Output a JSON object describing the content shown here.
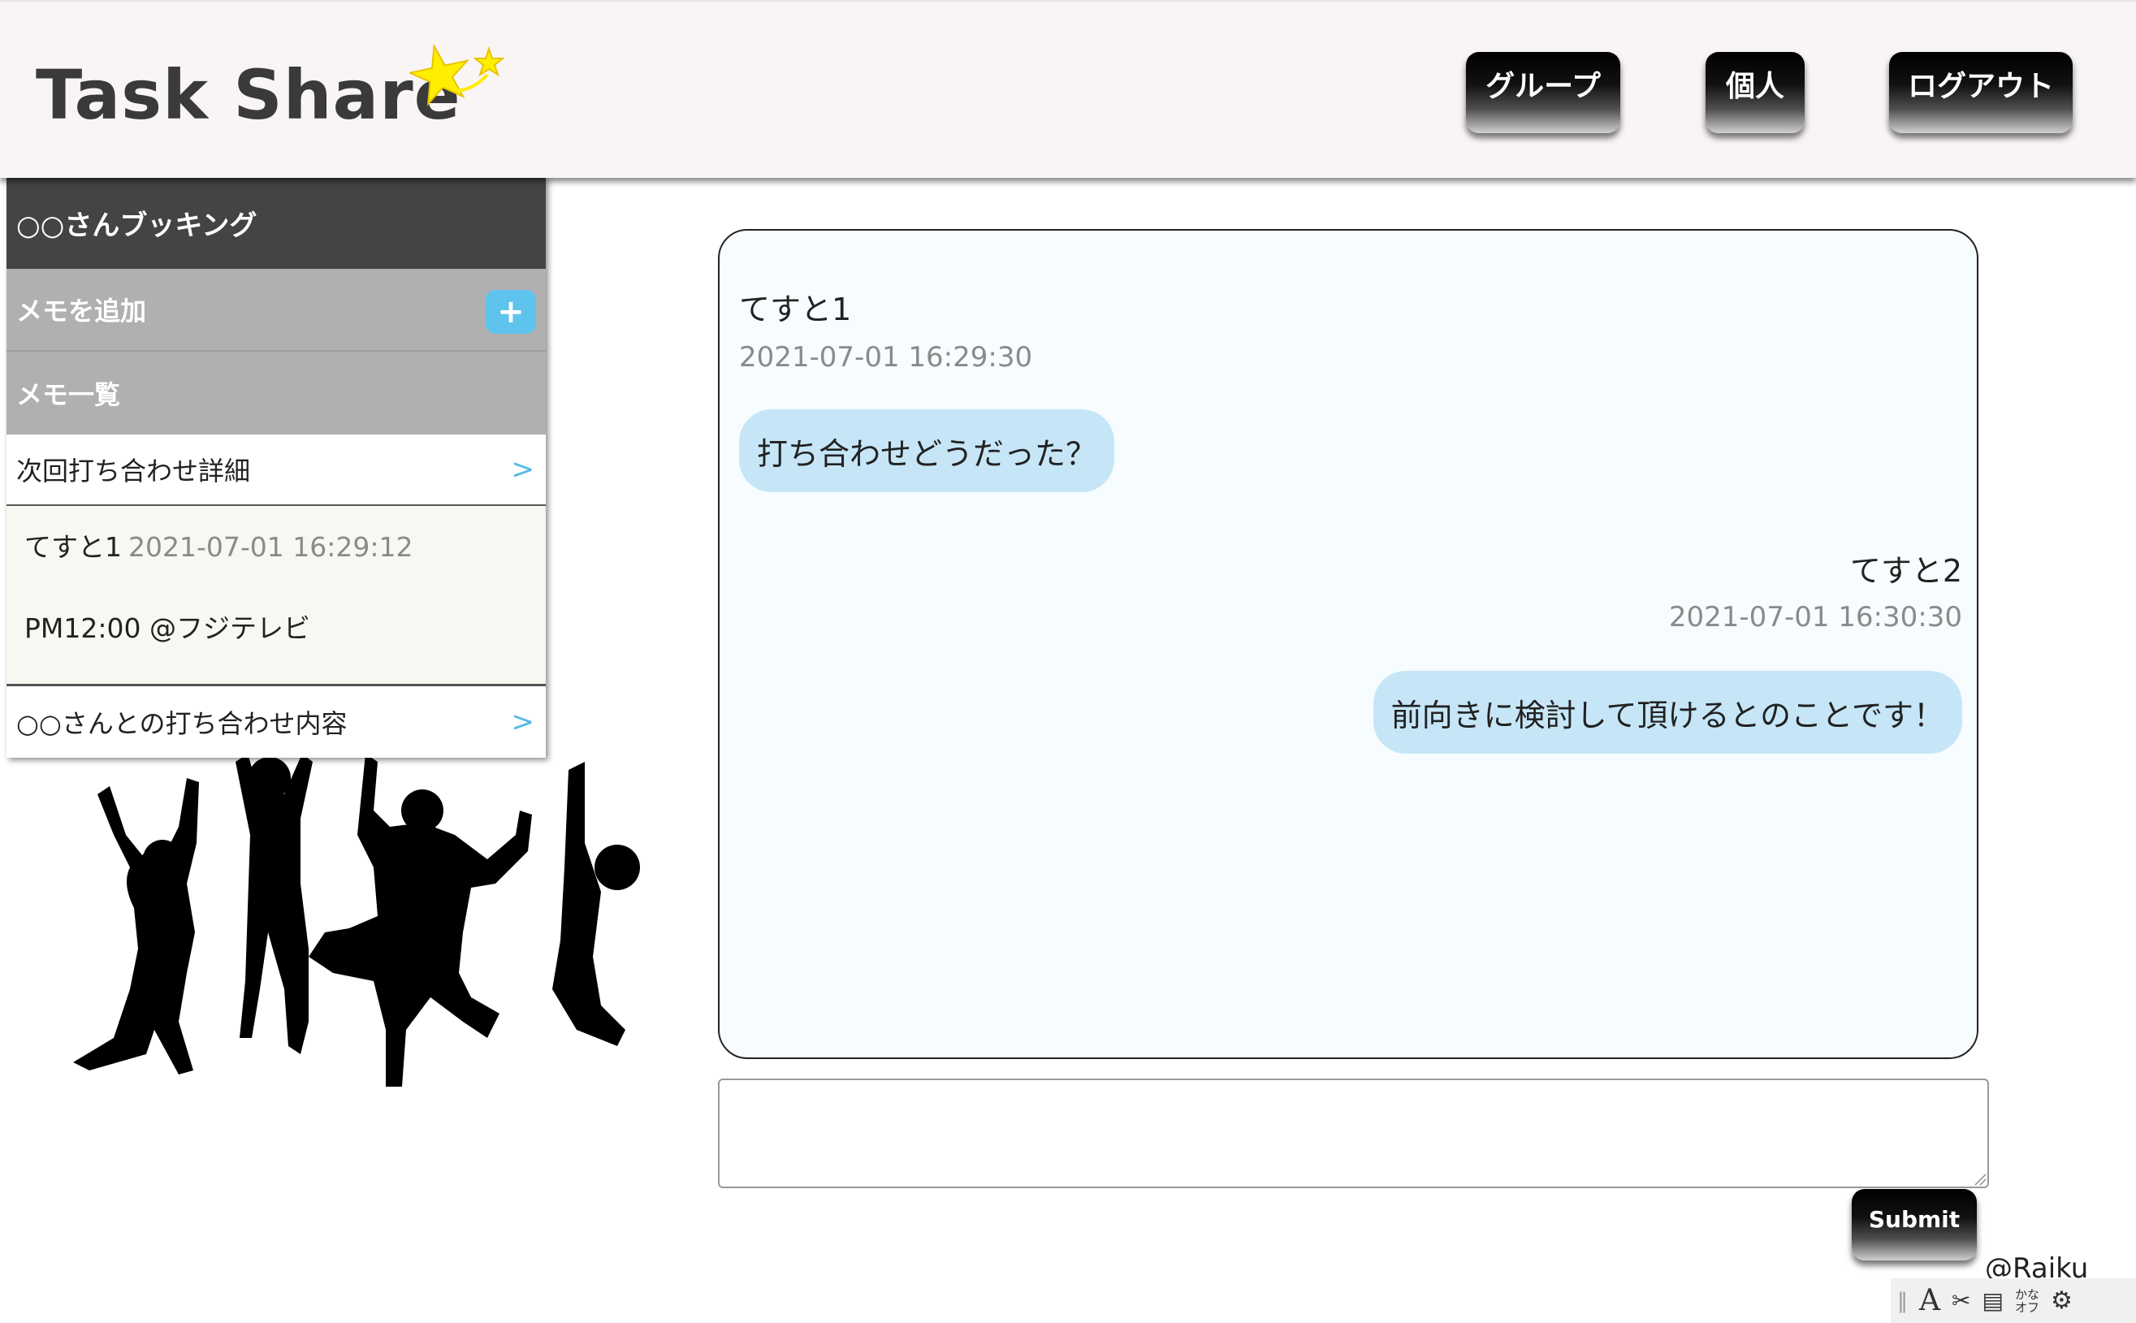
{
  "app": {
    "title": "Task Share",
    "accent_color": "#5ec4ee",
    "header_bg": "#faf5f5"
  },
  "nav": {
    "group_label": "グループ",
    "personal_label": "個人",
    "logout_label": "ログアウト"
  },
  "sidebar": {
    "title": "○○さんブッキング",
    "add_memo_label": "メモを追加",
    "add_icon": "plus-icon",
    "add_symbol": "+",
    "memo_list_label": "メモ一覧",
    "chevron": ">",
    "memos": [
      {
        "label": "次回打ち合わせ詳細",
        "expanded": true,
        "author": "てすと1",
        "timestamp": "2021-07-01 16:29:12",
        "body": "PM12:00 @フジテレビ"
      },
      {
        "label": "○○さんとの打ち合わせ内容",
        "expanded": false
      }
    ]
  },
  "chat": {
    "messages": [
      {
        "author": "てすと1",
        "timestamp": "2021-07-01 16:29:30",
        "text": "打ち合わせどうだった？",
        "side": "left"
      },
      {
        "author": "てすと2",
        "timestamp": "2021-07-01 16:30:30",
        "text": "前向きに検討して頂けるとのことです！",
        "side": "right"
      }
    ],
    "bubble_color": "#c6e6f7"
  },
  "composer": {
    "value": "",
    "submit_label": "Submit"
  },
  "footer": {
    "credit": "@Raiku"
  },
  "ime_toolbar": {
    "mode_label": "A",
    "kana_line1": "かな",
    "kana_line2": "オフ",
    "icons": [
      "grip-icon",
      "ime-mode-icon",
      "tools-icon",
      "dictionary-add-icon",
      "kana-toggle",
      "settings-gear-icon"
    ]
  }
}
